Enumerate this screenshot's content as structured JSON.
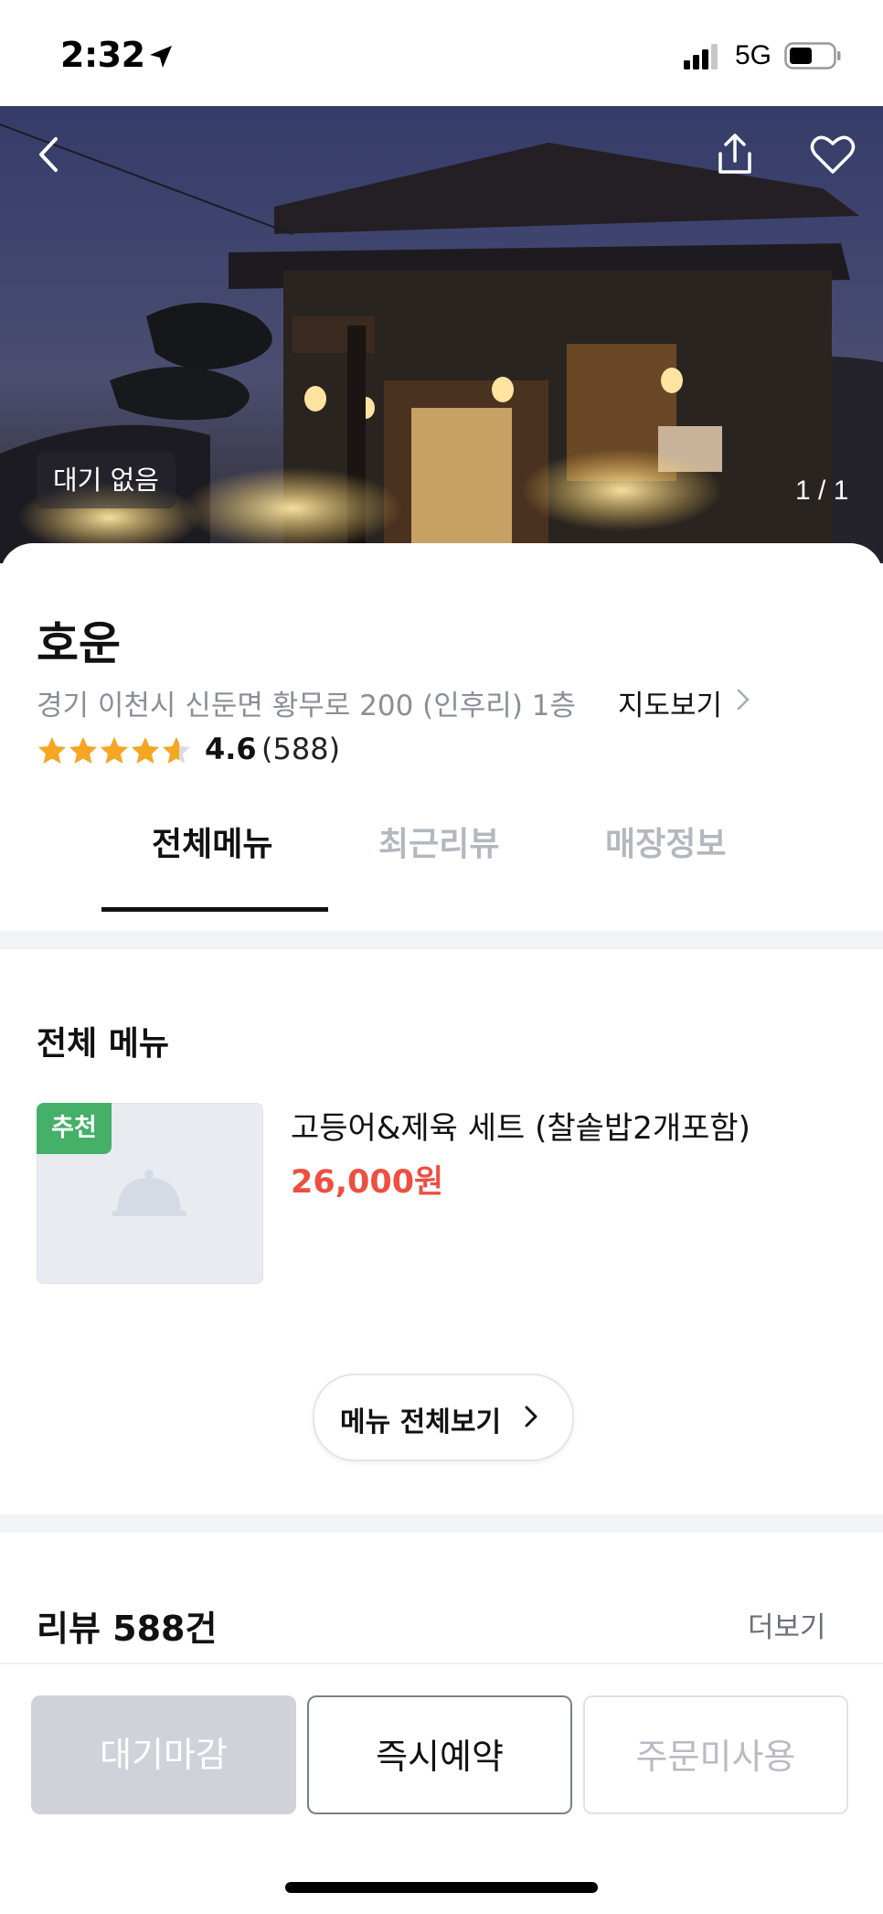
{
  "status_bar": {
    "time": "2:32",
    "network": "5G",
    "icons": [
      "location-arrow-icon",
      "signal-bars-icon",
      "battery-icon"
    ]
  },
  "hero": {
    "wait_status": "대기 없음",
    "photo_counter": "1 / 1",
    "icons": [
      "back-chevron-icon",
      "share-icon",
      "heart-icon"
    ]
  },
  "store": {
    "name": "호운",
    "address": "경기 이천시 신둔면 황무로 200 (인후리) 1층",
    "map_link": "지도보기",
    "rating": "4.6",
    "review_count": "(588)",
    "stars_filled": 4.6
  },
  "tabs": [
    {
      "label": "전체메뉴",
      "active": true
    },
    {
      "label": "최근리뷰",
      "active": false
    },
    {
      "label": "매장정보",
      "active": false
    }
  ],
  "menu_section": {
    "title": "전체 메뉴",
    "items": [
      {
        "badge": "추천",
        "name": "고등어&제육 세트 (찰솥밥2개포함)",
        "price": "26,000원"
      }
    ],
    "more_button": "메뉴 전체보기"
  },
  "review_section": {
    "title": "리뷰 588건",
    "more_link": "더보기"
  },
  "bottom_actions": {
    "waiting_closed": "대기마감",
    "instant_reserve": "즉시예약",
    "no_order": "주문미사용"
  },
  "colors": {
    "accent_price": "#ee4f40",
    "badge_green": "#44b068",
    "star": "#f5a623"
  }
}
